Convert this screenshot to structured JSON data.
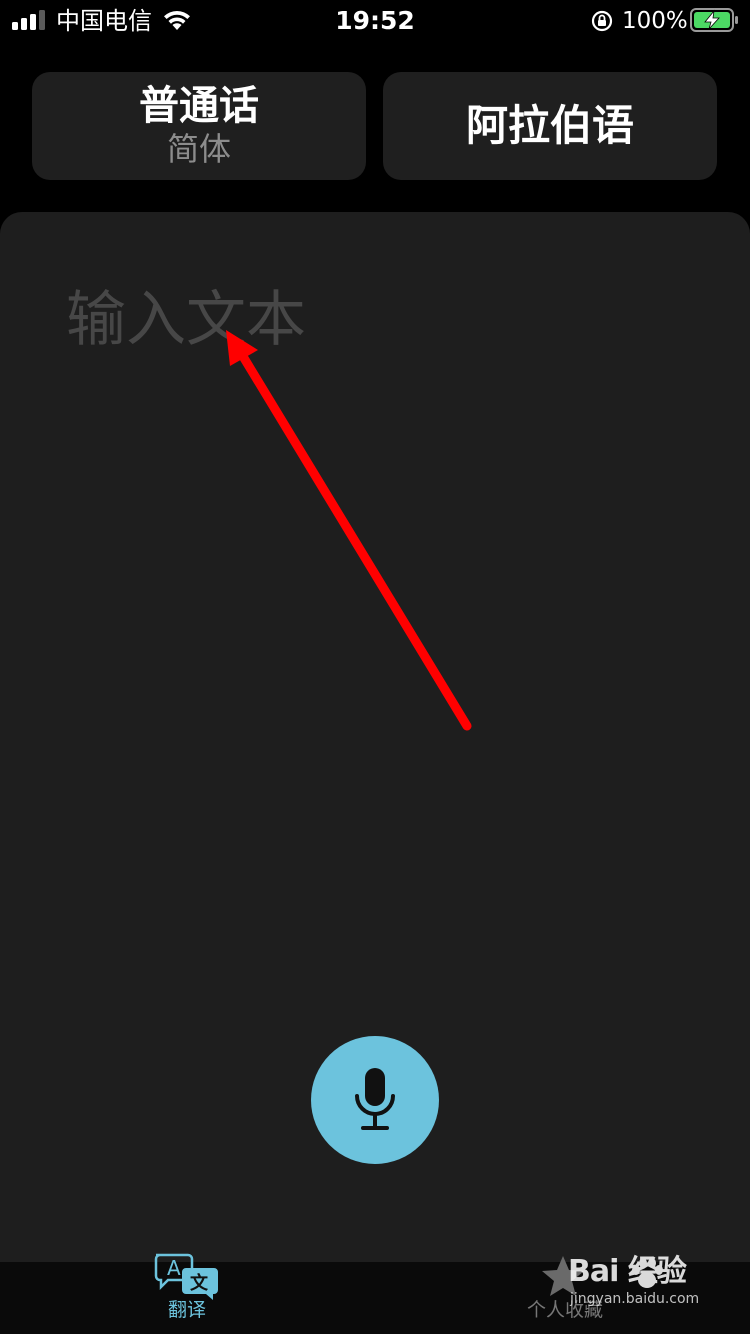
{
  "status_bar": {
    "carrier": "中国电信",
    "time": "19:52",
    "battery_percent": "100%",
    "signal_bars": 3,
    "icons": [
      "signal-icon",
      "wifi-icon",
      "rotation-lock-icon",
      "battery-charging-icon"
    ]
  },
  "languages": {
    "source": {
      "name": "普通话",
      "variant": "简体"
    },
    "target": {
      "name": "阿拉伯语"
    }
  },
  "input": {
    "placeholder": "输入文本",
    "value": ""
  },
  "mic": {
    "icon": "microphone-icon"
  },
  "tabs": [
    {
      "label": "翻译",
      "icon": "translate-icon",
      "active": true
    },
    {
      "label": "个人收藏",
      "icon": "star-icon",
      "active": false
    }
  ],
  "watermark": {
    "logo": "Bai  经验",
    "url": "jingyan.baidu.com"
  },
  "colors": {
    "accent": "#6cc3dd",
    "panel": "#1e1e1e",
    "button": "#1f1f1f",
    "annotation": "#ff0000"
  }
}
